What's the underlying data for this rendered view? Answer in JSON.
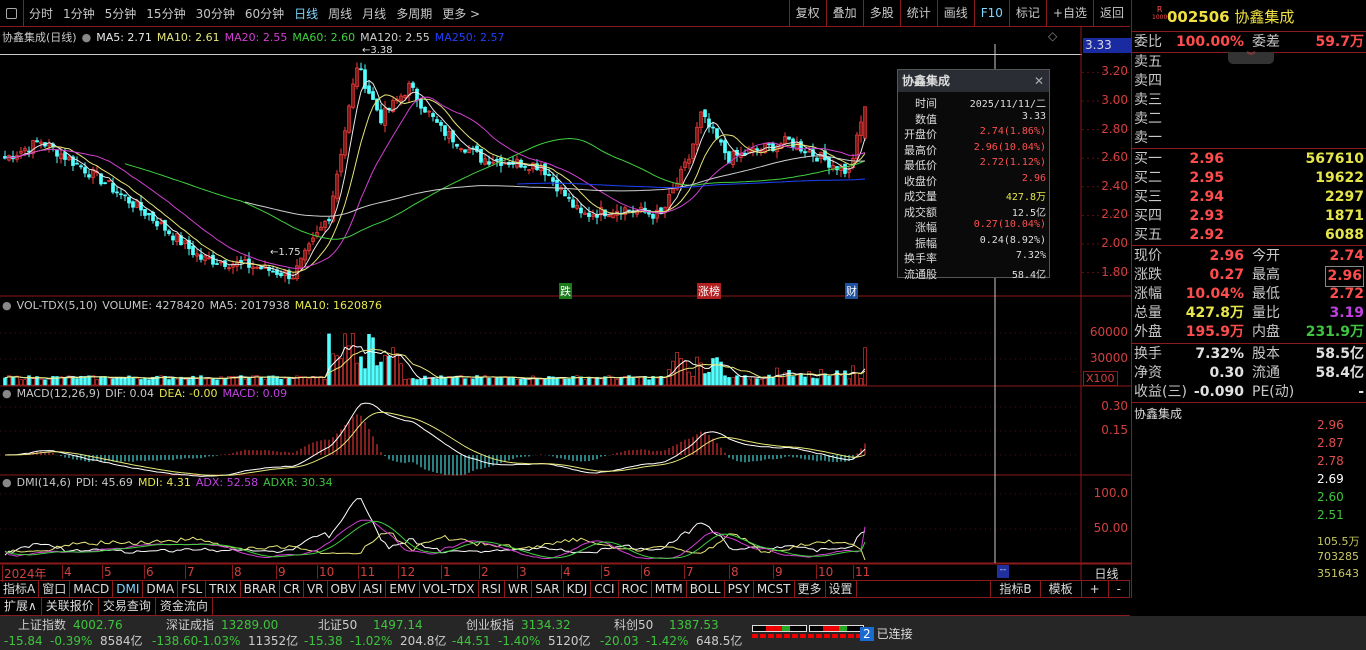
{
  "toolbar": {
    "periods": [
      "分时",
      "1分钟",
      "5分钟",
      "15分钟",
      "30分钟",
      "60分钟",
      "日线",
      "周线",
      "月线",
      "多周期",
      "更多 >"
    ],
    "active": "日线",
    "buttons": [
      "复权",
      "叠加",
      "多股",
      "统计",
      "画线",
      "F10",
      "标记",
      "+自选",
      "返回"
    ]
  },
  "main": {
    "title": "协鑫集成(日线)",
    "ma": [
      {
        "t": "MA5: 2.71",
        "c": "#e8e8e8"
      },
      {
        "t": "MA10: 2.61",
        "c": "#e6e67a"
      },
      {
        "t": "MA20: 2.55",
        "c": "#d040d0"
      },
      {
        "t": "MA60: 2.60",
        "c": "#40d040"
      },
      {
        "t": "MA120: 2.55",
        "c": "#cfcfcf"
      },
      {
        "t": "MA250: 2.57",
        "c": "#2040ff"
      }
    ],
    "price_axis": [
      "3.20",
      "3.00",
      "2.80",
      "2.60",
      "2.40",
      "2.20",
      "2.00",
      "1.80"
    ],
    "cursor_value": "3.33",
    "high_label": "3.38",
    "low_label": "1.75",
    "markers": [
      {
        "t": "跌",
        "c": "#1a7a1a"
      },
      {
        "t": "涨榜",
        "c": "#b02020"
      },
      {
        "t": "财",
        "c": "#2050a0"
      }
    ]
  },
  "tooltip": {
    "title": "协鑫集成",
    "rows": [
      {
        "k": "时间",
        "v": "2025/11/11/二",
        "c": "#ddd"
      },
      {
        "k": "数值",
        "v": "3.33",
        "c": "#ddd"
      },
      {
        "k": "开盘价",
        "v": "2.74(1.86%)",
        "c": "#ff5050"
      },
      {
        "k": "最高价",
        "v": "2.96(10.04%)",
        "c": "#ff5050"
      },
      {
        "k": "最低价",
        "v": "2.72(1.12%)",
        "c": "#ff5050"
      },
      {
        "k": "收盘价",
        "v": "2.96",
        "c": "#ff5050"
      },
      {
        "k": "成交量",
        "v": "427.8万",
        "c": "#e6e64c"
      },
      {
        "k": "成交额",
        "v": "12.5亿",
        "c": "#ddd"
      },
      {
        "k": "涨幅",
        "v": "0.27(10.04%)",
        "c": "#ff5050"
      },
      {
        "k": "振幅",
        "v": "0.24(8.92%)",
        "c": "#ddd"
      },
      {
        "k": "换手率",
        "v": "7.32%",
        "c": "#ddd"
      },
      {
        "k": "流通股",
        "v": "58.4亿",
        "c": "#ddd"
      }
    ]
  },
  "vol": {
    "title": "VOL-TDX(5,10)",
    "volume": "VOLUME: 4278420",
    "ma5": "MA5: 2017938",
    "ma10": "MA10: 1620876",
    "axis": [
      "60000",
      "30000"
    ],
    "unit": "X100"
  },
  "macd": {
    "title": "MACD(12,26,9)",
    "dif": "DIF: 0.04",
    "dea": "DEA: -0.00",
    "macd": "MACD: 0.09",
    "axis": [
      "0.30",
      "0.15"
    ]
  },
  "dmi": {
    "title": "DMI(14,6)",
    "pdi": "PDI: 45.69",
    "mdi": "MDI: 4.31",
    "adx": "ADX: 52.58",
    "adxr": "ADXR: 30.34",
    "axis": [
      "100.0",
      "50.00"
    ]
  },
  "dates": [
    "2024年",
    "4",
    "5",
    "6",
    "7",
    "8",
    "9",
    "10",
    "11",
    "12",
    "1",
    "2",
    "3",
    "4",
    "5",
    "6",
    "7",
    "8",
    "9",
    "10",
    "11"
  ],
  "period_label": "日线",
  "tabs_a": [
    "指标A",
    "窗口",
    "MACD",
    "DMI",
    "DMA",
    "FSL",
    "TRIX",
    "BRAR",
    "CR",
    "VR",
    "OBV",
    "ASI",
    "EMV",
    "VOL-TDX",
    "RSI",
    "WR",
    "SAR",
    "KDJ",
    "CCI",
    "ROC",
    "MTM",
    "BOLL",
    "PSY",
    "MCST",
    "更多",
    "设置"
  ],
  "tabs_active": "DMI",
  "tabs_b": [
    "指标B",
    "模板",
    "+",
    "-"
  ],
  "ext": [
    "扩展∧",
    "关联报价",
    "交易查询",
    "资金流向"
  ],
  "quote": {
    "code": "002506",
    "name": "协鑫集成",
    "badge_top": "R",
    "badge_bottom": "1000",
    "weibi_label": "委比",
    "weibi": "100.00%",
    "weicha_label": "委差",
    "weicha": "59.7万",
    "sells": [
      "卖五",
      "卖四",
      "卖三",
      "卖二",
      "卖一"
    ],
    "buys": [
      {
        "l": "买一",
        "p": "2.96",
        "v": "567610"
      },
      {
        "l": "买二",
        "p": "2.95",
        "v": "19622"
      },
      {
        "l": "买三",
        "p": "2.94",
        "v": "2297"
      },
      {
        "l": "买四",
        "p": "2.93",
        "v": "1871"
      },
      {
        "l": "买五",
        "p": "2.92",
        "v": "6088"
      }
    ],
    "stats": [
      {
        "l": "现价",
        "v": "2.96",
        "vc": "red",
        "l2": "今开",
        "v2": "2.74",
        "v2c": "red"
      },
      {
        "l": "涨跌",
        "v": "0.27",
        "vc": "red",
        "l2": "最高",
        "v2": "2.96",
        "v2c": "red"
      },
      {
        "l": "涨幅",
        "v": "10.04%",
        "vc": "red",
        "l2": "最低",
        "v2": "2.72",
        "v2c": "red"
      },
      {
        "l": "总量",
        "v": "427.8万",
        "vc": "yel",
        "l2": "量比",
        "v2": "3.19",
        "v2c": "pur"
      },
      {
        "l": "外盘",
        "v": "195.9万",
        "vc": "red",
        "l2": "内盘",
        "v2": "231.9万",
        "v2c": "grn"
      }
    ],
    "fund": [
      {
        "l": "换手",
        "v": "7.32%",
        "l2": "股本",
        "v2": "58.5亿"
      },
      {
        "l": "净资",
        "v": "0.30",
        "l2": "流通",
        "v2": "58.4亿"
      },
      {
        "l": "收益(三)",
        "v": "-0.090",
        "l2": "PE(动)",
        "v2": "-"
      }
    ],
    "intraday_title": "协鑫集成",
    "intraday_axis": [
      "2.96",
      "2.87",
      "2.78",
      "2.69",
      "2.60",
      "2.51"
    ],
    "intraday_vol_axis": [
      "105.5万",
      "703285",
      "351643"
    ]
  },
  "status": {
    "indices": [
      {
        "n": "上证指数",
        "p": "4002.76",
        "c": "-15.84",
        "pct": "-0.39%",
        "amt": "8584亿"
      },
      {
        "n": "深证成指",
        "p": "13289.00",
        "c": "-138.60",
        "pct": "-1.03%",
        "amt": "11352亿"
      },
      {
        "n": "北证50",
        "p": "1497.14",
        "c": "-15.38",
        "pct": "-1.02%",
        "amt": "204.8亿"
      },
      {
        "n": "创业板指",
        "p": "3134.32",
        "c": "-44.51",
        "pct": "-1.40%",
        "amt": "5120亿"
      },
      {
        "n": "科创50",
        "p": "1387.53",
        "c": "-20.03",
        "pct": "-1.42%",
        "amt": "648.5亿"
      }
    ],
    "conn_num": "2",
    "conn": "已连接"
  },
  "chart_data": {
    "type": "candlestick",
    "bars": 216,
    "keypoints": [
      [
        0,
        2.6
      ],
      [
        9,
        2.72
      ],
      [
        24,
        2.45
      ],
      [
        36,
        2.2
      ],
      [
        49,
        1.9
      ],
      [
        61,
        1.85
      ],
      [
        72,
        1.78
      ],
      [
        81,
        2.2
      ],
      [
        88,
        3.25
      ],
      [
        94,
        2.88
      ],
      [
        101,
        3.1
      ],
      [
        109,
        2.8
      ],
      [
        119,
        2.6
      ],
      [
        134,
        2.55
      ],
      [
        144,
        2.2
      ],
      [
        154,
        2.25
      ],
      [
        164,
        2.2
      ],
      [
        171,
        2.6
      ],
      [
        174,
        2.9
      ],
      [
        181,
        2.6
      ],
      [
        196,
        2.72
      ],
      [
        211,
        2.5
      ],
      [
        215,
        2.96
      ]
    ],
    "last": {
      "open": 2.74,
      "high": 2.96,
      "low": 2.72,
      "close": 2.96
    }
  }
}
